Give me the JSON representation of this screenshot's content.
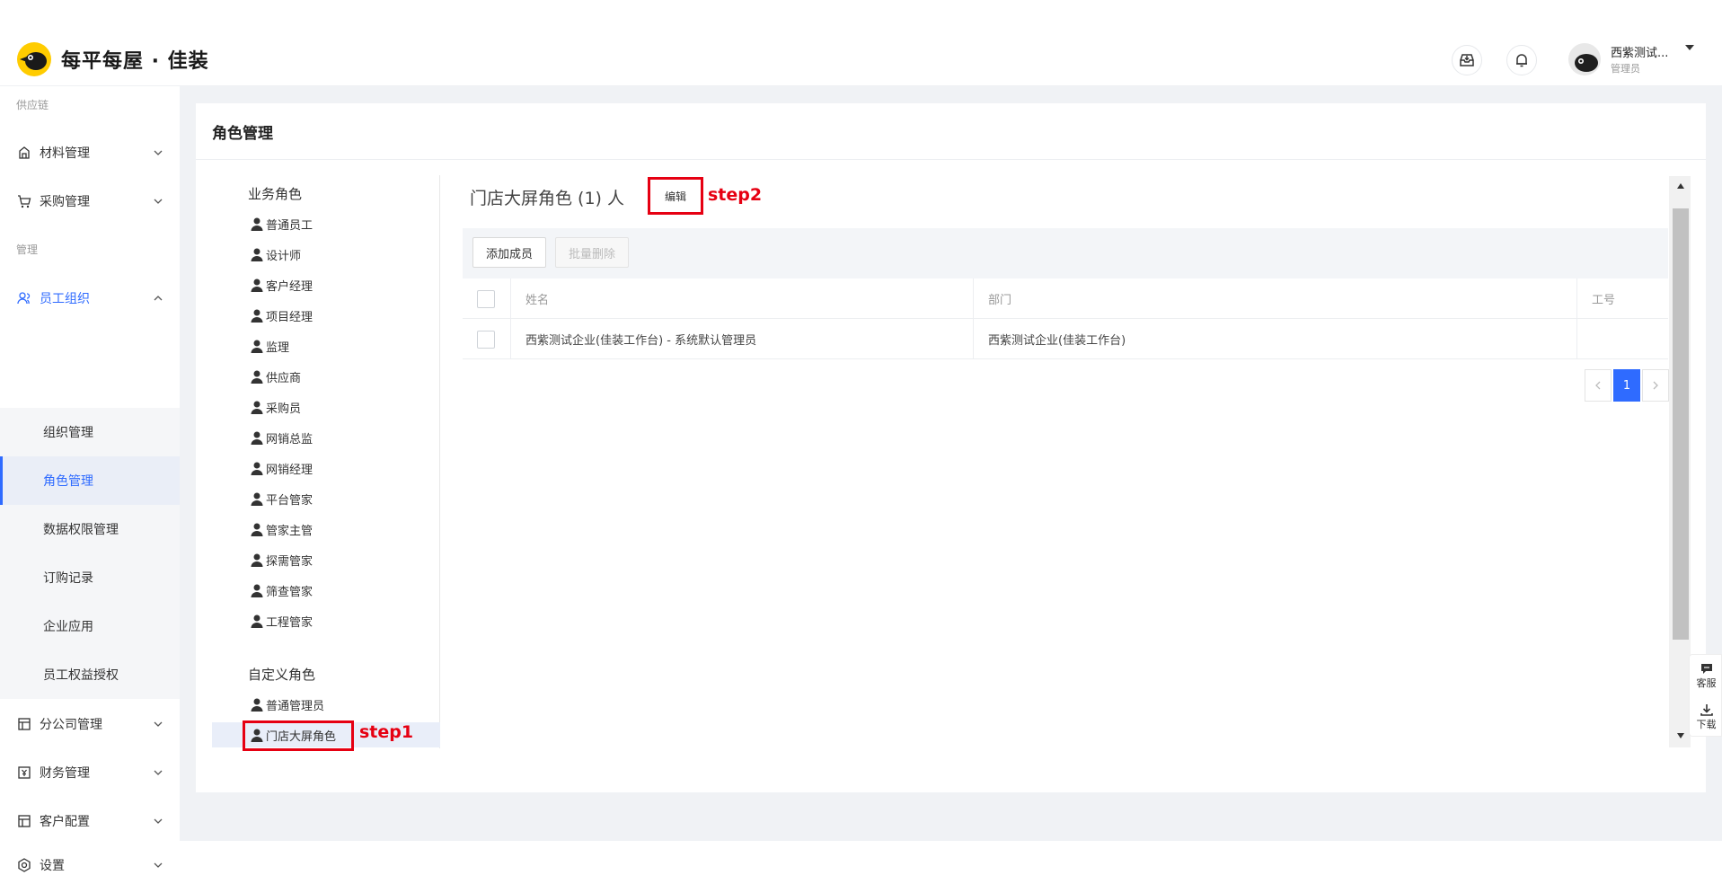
{
  "header": {
    "brand": "每平每屋 · 佳装",
    "user_name": "西紫测试...",
    "user_role": "管理员"
  },
  "sidebar": {
    "group_supply": "供应链",
    "group_manage": "管理",
    "items": {
      "materials": "材料管理",
      "purchase": "采购管理",
      "staff_org": "员工组织",
      "branch": "分公司管理",
      "finance": "财务管理",
      "customer": "客户配置",
      "settings": "设置"
    },
    "sub_items": [
      "组织管理",
      "角色管理",
      "数据权限管理",
      "订购记录",
      "企业应用",
      "员工权益授权"
    ]
  },
  "page": {
    "title": "角色管理"
  },
  "roles": {
    "business_heading": "业务角色",
    "business": [
      "普通员工",
      "设计师",
      "客户经理",
      "项目经理",
      "监理",
      "供应商",
      "采购员",
      "网销总监",
      "网销经理",
      "平台管家",
      "管家主管",
      "探需管家",
      "筛查管家",
      "工程管家"
    ],
    "custom_heading": "自定义角色",
    "custom": [
      "普通管理员",
      "门店大屏角色"
    ],
    "selected": "门店大屏角色"
  },
  "detail": {
    "role_title": "门店大屏角色 (1) 人",
    "edit_label": "编辑",
    "add_member_label": "添加成员",
    "batch_delete_label": "批量删除",
    "columns": [
      "姓名",
      "部门",
      "工号"
    ],
    "rows": [
      {
        "name": "西紫测试企业(佳装工作台) - 系统默认管理员",
        "dept": "西紫测试企业(佳装工作台)",
        "id": ""
      }
    ],
    "current_page": "1"
  },
  "annotations": {
    "step1": "step1",
    "step2": "step2"
  },
  "float": {
    "service": "客服",
    "download": "下载"
  },
  "colors": {
    "accent": "#2f6bff",
    "annotation": "#e60012",
    "brand_yellow": "#ffcc00"
  }
}
